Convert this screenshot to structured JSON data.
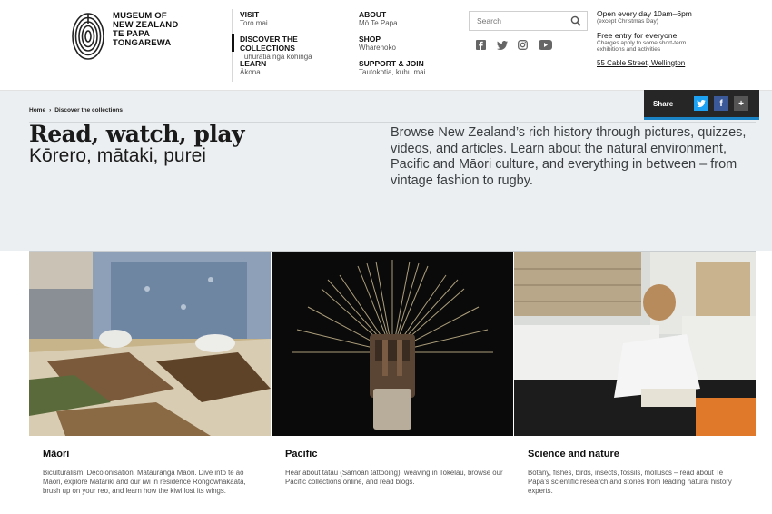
{
  "logo": {
    "line1": "MUSEUM OF",
    "line2": "NEW ZEALAND",
    "line3": "TE PAPA",
    "line4": "TONGAREWA",
    "icon": "fingerprint-icon"
  },
  "nav": {
    "col1": [
      {
        "title": "VISIT",
        "sub": "Toro mai"
      },
      {
        "title": "DISCOVER THE COLLECTIONS",
        "sub": "Tūhuratia ngā kohinga"
      },
      {
        "title": "LEARN",
        "sub": "Ākona"
      }
    ],
    "col2": [
      {
        "title": "ABOUT",
        "sub": "Mō Te Papa"
      },
      {
        "title": "SHOP",
        "sub": "Wharehoko"
      },
      {
        "title": "SUPPORT & JOIN",
        "sub": "Tautokotia, kuhu mai"
      }
    ]
  },
  "search": {
    "placeholder": "Search",
    "icon": "search-icon"
  },
  "social": [
    "facebook-icon",
    "twitter-icon",
    "instagram-icon",
    "youtube-icon"
  ],
  "info": {
    "open": "Open every day 10am–6pm",
    "open_note": "(except Christmas Day)",
    "entry": "Free entry for everyone",
    "entry_note1": "Charges apply to some short-term",
    "entry_note2": "exhibitions and activities",
    "address": "55 Cable Street, Wellington"
  },
  "breadcrumb": {
    "home": "Home",
    "separator": "›",
    "current": "Discover the collections"
  },
  "hero": {
    "title_en": "Read, watch, play",
    "title_mi": "Kōrero, mātaki, purei",
    "intro": "Browse New Zealand’s rich history through pictures, quizzes, videos, and articles. Learn about the natural environment, Pacific and Māori culture, and everything in between – from vintage fashion to rugby."
  },
  "share": {
    "label": "Share",
    "twitter": "t",
    "facebook": "f",
    "more": "+"
  },
  "cards": [
    {
      "title": "Māori",
      "desc": "Biculturalism. Decolonisation. Mātauranga Māori. Dive into te ao Māori, explore Matariki and our iwi in residence Rongowhakaata, brush up on your reo, and learn how the kiwi lost its wings."
    },
    {
      "title": "Pacific",
      "desc": "Hear about tatau (Sāmoan tattooing), weaving in Tokelau, browse our Pacific collections online, and read blogs."
    },
    {
      "title": "Science and nature",
      "desc": "Botany, fishes, birds, insects, fossils, molluscs – read about Te Papa’s scientific research and stories from leading natural history experts."
    }
  ],
  "colors": {
    "accent": "#1a84c7",
    "hero_bg": "#eceff1",
    "share_bg": "#262626"
  }
}
